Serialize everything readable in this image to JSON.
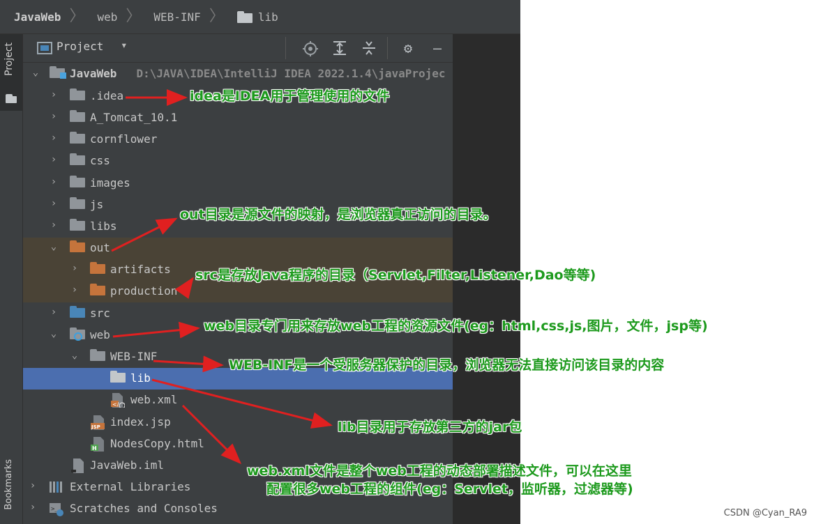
{
  "breadcrumb": [
    {
      "label": "JavaWeb"
    },
    {
      "label": "web"
    },
    {
      "label": "WEB-INF"
    },
    {
      "label": "lib"
    }
  ],
  "toolwindow": {
    "project_tab": "Project",
    "bookmarks_tab": "Bookmarks",
    "header_title": "Project"
  },
  "tree": {
    "root": {
      "label": "JavaWeb",
      "path": "D:\\JAVA\\IDEA\\IntelliJ IDEA 2022.1.4\\javaProjec"
    },
    "items": [
      {
        "label": ".idea"
      },
      {
        "label": "A_Tomcat_10.1"
      },
      {
        "label": "cornflower"
      },
      {
        "label": "css"
      },
      {
        "label": "images"
      },
      {
        "label": "js"
      },
      {
        "label": "libs"
      },
      {
        "label": "out"
      },
      {
        "label": "artifacts"
      },
      {
        "label": "production"
      },
      {
        "label": "src"
      },
      {
        "label": "web"
      },
      {
        "label": "WEB-INF"
      },
      {
        "label": "lib"
      },
      {
        "label": "web.xml"
      },
      {
        "label": "index.jsp"
      },
      {
        "label": "NodesCopy.html"
      },
      {
        "label": "JavaWeb.iml"
      },
      {
        "label": "External Libraries"
      },
      {
        "label": "Scratches and Consoles"
      }
    ]
  },
  "annotations": {
    "idea": "idea是IDEA用于管理使用的文件",
    "out": "out目录是源文件的映射，是浏览器真正访问的目录。",
    "src": "src是存放Java程序的目录（Servlet,Filter,Listener,Dao等等)",
    "web": "web目录专门用来存放web工程的资源文件(eg：html,css,js,图片，文件，jsp等)",
    "webinf": "WEB-INF是一个受服务器保护的目录，浏览器无法直接访问该目录的内容",
    "lib": "lib目录用于存放第三方的jar包",
    "webxml_line1": "web.xml文件是整个web工程的动态部署描述文件，可以在这里",
    "webxml_line2": "配置很多web工程的组件(eg：Servlet，监听器，过滤器等)"
  },
  "watermark": "CSDN @Cyan_RA9",
  "colors": {
    "annotation_text": "#1d9a1d",
    "arrow": "#e02020",
    "selection": "#4b6eaf"
  }
}
